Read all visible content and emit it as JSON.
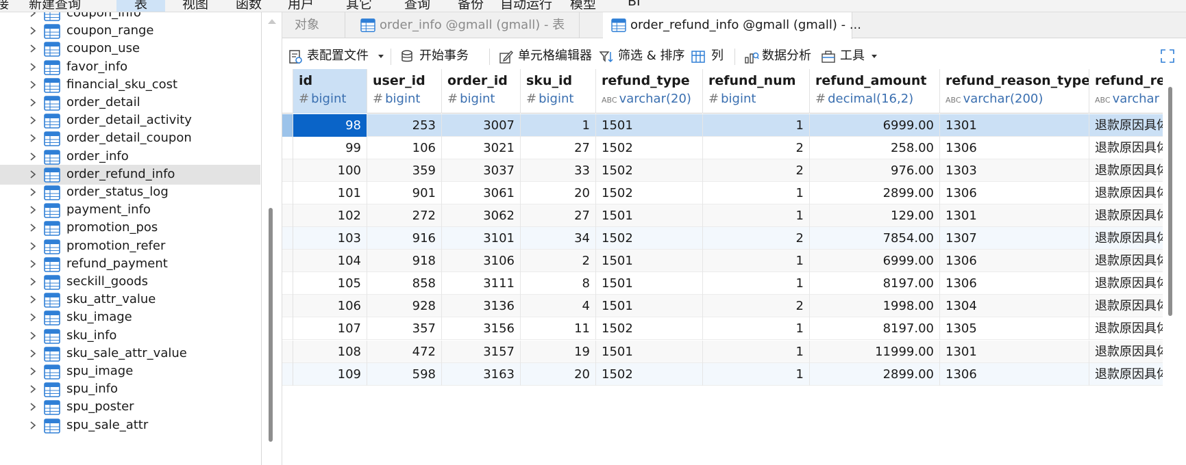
{
  "menu": [
    "表",
    "视图",
    "函数",
    "用户",
    "其它",
    "查询",
    "备份",
    "自动运行",
    "模型",
    "BI"
  ],
  "menu_left": [
    "接",
    "新建查询"
  ],
  "tree": {
    "items": [
      {
        "label": "coupon_info"
      },
      {
        "label": "coupon_range"
      },
      {
        "label": "coupon_use"
      },
      {
        "label": "favor_info"
      },
      {
        "label": "financial_sku_cost"
      },
      {
        "label": "order_detail"
      },
      {
        "label": "order_detail_activity"
      },
      {
        "label": "order_detail_coupon"
      },
      {
        "label": "order_info"
      },
      {
        "label": "order_refund_info",
        "selected": true
      },
      {
        "label": "order_status_log"
      },
      {
        "label": "payment_info"
      },
      {
        "label": "promotion_pos"
      },
      {
        "label": "promotion_refer"
      },
      {
        "label": "refund_payment"
      },
      {
        "label": "seckill_goods"
      },
      {
        "label": "sku_attr_value"
      },
      {
        "label": "sku_image"
      },
      {
        "label": "sku_info"
      },
      {
        "label": "sku_sale_attr_value"
      },
      {
        "label": "spu_image"
      },
      {
        "label": "spu_info"
      },
      {
        "label": "spu_poster"
      },
      {
        "label": "spu_sale_attr"
      }
    ]
  },
  "tabs": [
    {
      "label": "对象",
      "active": false,
      "icon": false
    },
    {
      "label": "order_info @gmall (gmall) - 表",
      "active": false,
      "icon": true
    },
    {
      "label": "order_refund_info @gmall (gmall) - ...",
      "active": true,
      "icon": true
    }
  ],
  "toolbar": {
    "table_profile": "表配置文件",
    "begin_transaction": "开始事务",
    "cell_editor": "单元格编辑器",
    "filter_sort": "筛选 & 排序",
    "columns": "列",
    "data_analysis": "数据分析",
    "tools": "工具"
  },
  "grid": {
    "columns": [
      {
        "name": "id",
        "type": "bigint",
        "type_glyph": "#"
      },
      {
        "name": "user_id",
        "type": "bigint",
        "type_glyph": "#"
      },
      {
        "name": "order_id",
        "type": "bigint",
        "type_glyph": "#"
      },
      {
        "name": "sku_id",
        "type": "bigint",
        "type_glyph": "#"
      },
      {
        "name": "refund_type",
        "type": "varchar(20)",
        "type_glyph": "ABC"
      },
      {
        "name": "refund_num",
        "type": "bigint",
        "type_glyph": "#"
      },
      {
        "name": "refund_amount",
        "type": "decimal(16,2)",
        "type_glyph": "#"
      },
      {
        "name": "refund_reason_type",
        "type": "varchar(200)",
        "type_glyph": "ABC"
      },
      {
        "name": "refund_re",
        "type": "varchar",
        "type_glyph": "ABC"
      }
    ],
    "rows": [
      [
        "98",
        "253",
        "3007",
        "1",
        "1501",
        "1",
        "6999.00",
        "1301",
        "退款原因具体"
      ],
      [
        "99",
        "106",
        "3021",
        "27",
        "1502",
        "2",
        "258.00",
        "1306",
        "退款原因具体"
      ],
      [
        "100",
        "359",
        "3037",
        "33",
        "1502",
        "2",
        "976.00",
        "1303",
        "退款原因具体"
      ],
      [
        "101",
        "901",
        "3061",
        "20",
        "1502",
        "1",
        "2899.00",
        "1306",
        "退款原因具体"
      ],
      [
        "102",
        "272",
        "3062",
        "27",
        "1501",
        "1",
        "129.00",
        "1301",
        "退款原因具体"
      ],
      [
        "103",
        "916",
        "3101",
        "34",
        "1502",
        "2",
        "7854.00",
        "1307",
        "退款原因具体"
      ],
      [
        "104",
        "918",
        "3106",
        "2",
        "1501",
        "1",
        "6999.00",
        "1306",
        "退款原因具体"
      ],
      [
        "105",
        "858",
        "3111",
        "8",
        "1501",
        "1",
        "8197.00",
        "1306",
        "退款原因具体"
      ],
      [
        "106",
        "928",
        "3136",
        "4",
        "1501",
        "2",
        "1998.00",
        "1304",
        "退款原因具体"
      ],
      [
        "107",
        "357",
        "3156",
        "11",
        "1502",
        "1",
        "8197.00",
        "1305",
        "退款原因具体"
      ],
      [
        "108",
        "472",
        "3157",
        "19",
        "1501",
        "1",
        "11999.00",
        "1301",
        "退款原因具体"
      ],
      [
        "109",
        "598",
        "3163",
        "20",
        "1502",
        "1",
        "2899.00",
        "1306",
        "退款原因具体"
      ]
    ],
    "selected_row": 0,
    "current_cell": [
      0,
      0
    ]
  },
  "colors": {
    "accent": "#0a64c8",
    "selection": "#cbe0f5",
    "type_text": "#3a6fb0",
    "table_icon": "#2f7fd6"
  },
  "icons": {
    "table": "table-icon",
    "chevron": "chevron-right-icon"
  }
}
